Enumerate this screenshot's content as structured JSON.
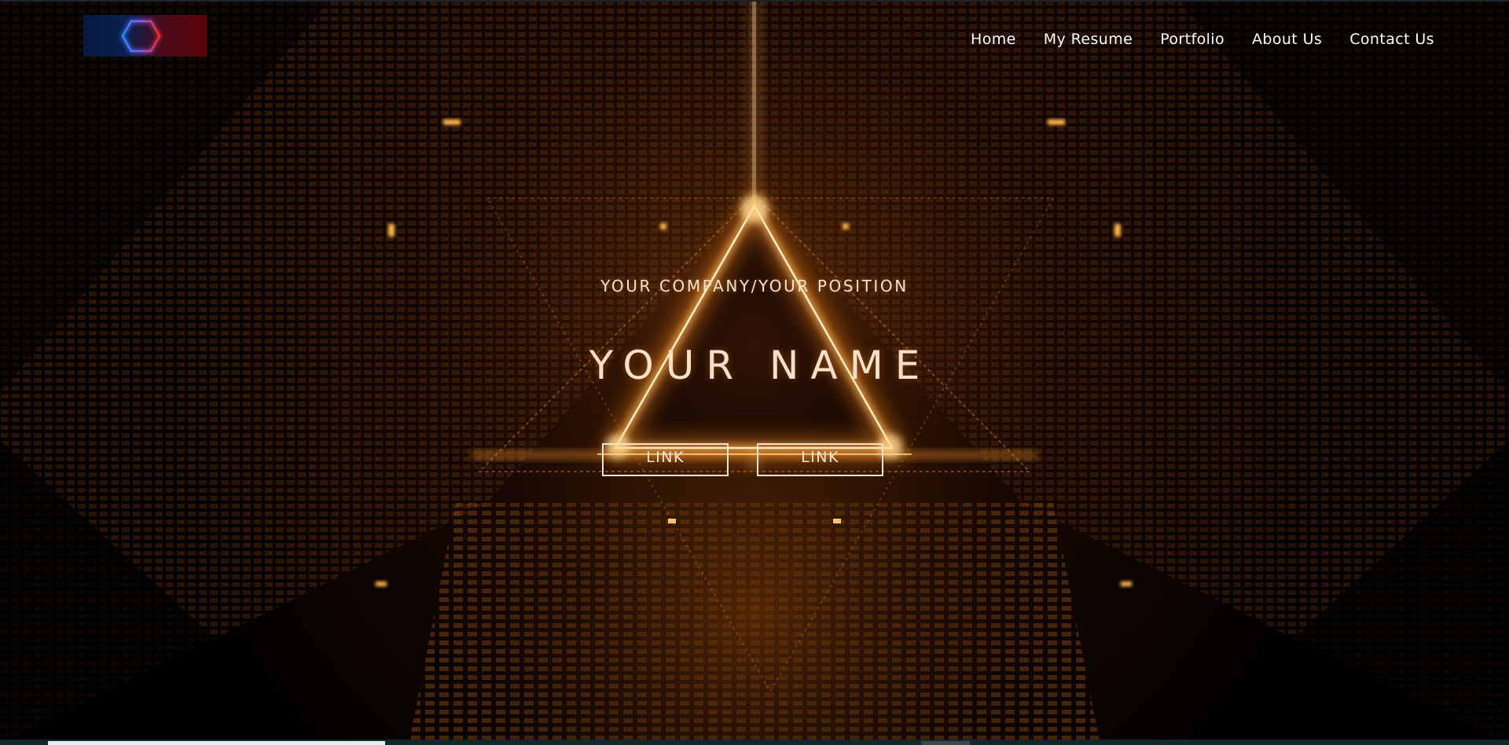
{
  "header": {
    "logo_name": "hexagon-logo",
    "nav": [
      {
        "label": "Home"
      },
      {
        "label": "My Resume"
      },
      {
        "label": "Portfolio"
      },
      {
        "label": "About Us"
      },
      {
        "label": "Contact Us"
      }
    ]
  },
  "hero": {
    "subtitle": "YOUR COMPANY/YOUR POSITION",
    "title": "YOUR NAME",
    "buttons": [
      {
        "label": "LINK"
      },
      {
        "label": "LINK"
      }
    ]
  },
  "colors": {
    "background": "#040100",
    "glow": "#ff9a2e",
    "text": "#f6e0c8",
    "logo_blue": "#2f8cff",
    "logo_red": "#ff2a2a"
  }
}
